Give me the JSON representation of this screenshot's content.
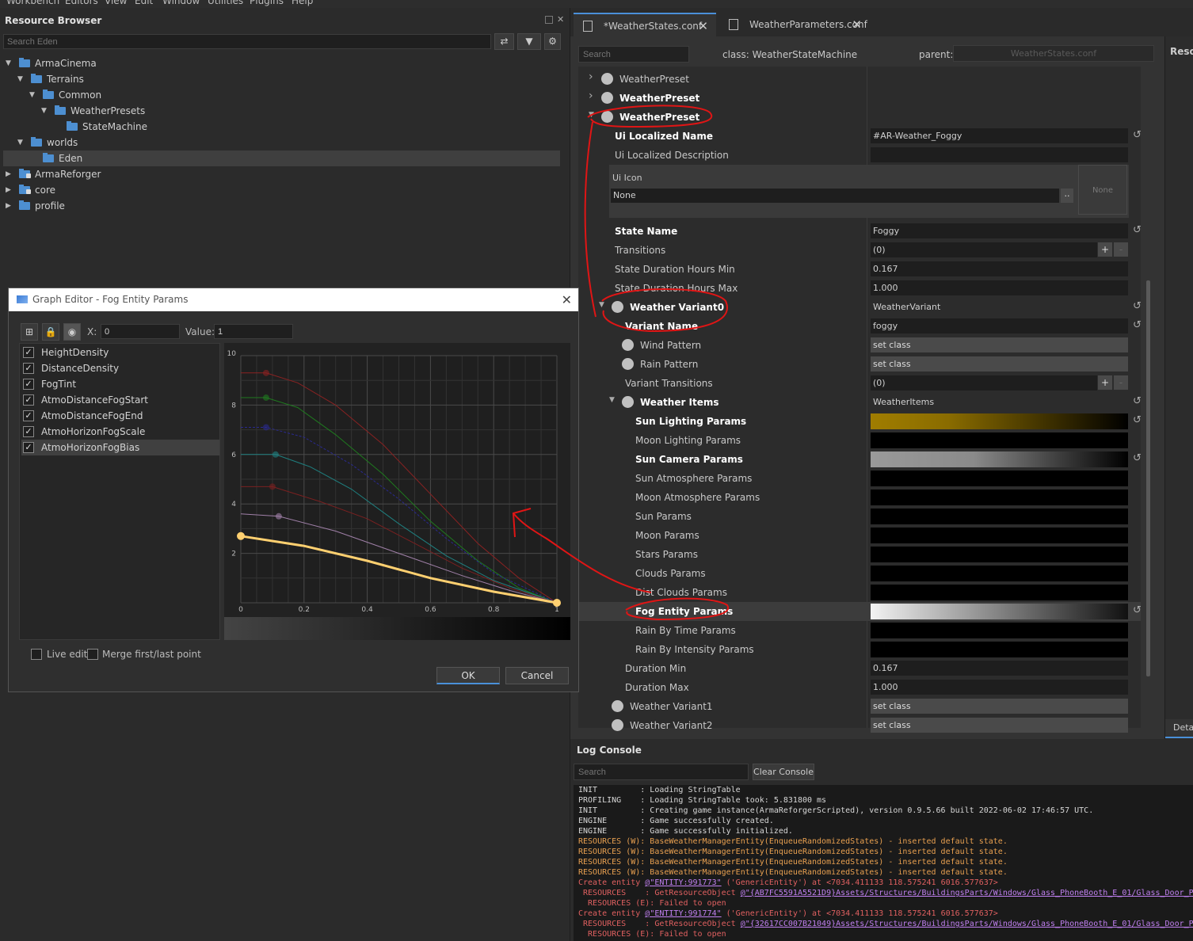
{
  "menu": [
    "Workbench",
    "Editors",
    "View",
    "Edit",
    "Window",
    "Utilities",
    "Plugins",
    "Help"
  ],
  "resource_browser": {
    "title": "Resource Browser",
    "search_placeholder": "Search Eden",
    "tree": [
      {
        "label": "ArmaCinema",
        "expanded": true
      },
      {
        "label": "Terrains",
        "expanded": true
      },
      {
        "label": "Common",
        "expanded": true
      },
      {
        "label": "WeatherPresets",
        "expanded": true
      },
      {
        "label": "StateMachine"
      },
      {
        "label": "worlds",
        "expanded": true
      },
      {
        "label": "Eden",
        "selected": true
      },
      {
        "label": "ArmaReforger",
        "locked": true
      },
      {
        "label": "core",
        "locked": true
      },
      {
        "label": "profile"
      }
    ]
  },
  "graph_editor": {
    "title": "Graph Editor - Fog Entity Params",
    "x_label": "X:",
    "x_value": "0",
    "value_label": "Value:",
    "value_value": "1",
    "items": [
      "HeightDensity",
      "DistanceDensity",
      "FogTint",
      "AtmoDistanceFogStart",
      "AtmoDistanceFogEnd",
      "AtmoHorizonFogScale",
      "AtmoHorizonFogBias"
    ],
    "live_edit": "Live edit",
    "merge": "Merge first/last point",
    "ok": "OK",
    "cancel": "Cancel"
  },
  "chart_data": {
    "type": "line",
    "x_ticks": [
      "0",
      "0.2",
      "0.4",
      "0.6",
      "0.8",
      "1"
    ],
    "y_ticks": [
      "2",
      "4",
      "6",
      "8",
      "10"
    ],
    "xlim": [
      0,
      1
    ],
    "ylim": [
      0,
      10
    ],
    "series": [
      {
        "color": "#8a2222",
        "points": [
          [
            0,
            9.3
          ],
          [
            0.08,
            9.3
          ],
          [
            0.18,
            8.9
          ],
          [
            0.3,
            8
          ],
          [
            0.45,
            6.4
          ],
          [
            0.6,
            4.4
          ],
          [
            0.75,
            2.4
          ],
          [
            0.88,
            1
          ],
          [
            1,
            0
          ]
        ]
      },
      {
        "color": "#1f7a1f",
        "points": [
          [
            0,
            8.3
          ],
          [
            0.08,
            8.3
          ],
          [
            0.18,
            7.9
          ],
          [
            0.3,
            6.8
          ],
          [
            0.45,
            5.2
          ],
          [
            0.6,
            3.3
          ],
          [
            0.75,
            1.7
          ],
          [
            0.88,
            0.6
          ],
          [
            1,
            0
          ]
        ]
      },
      {
        "color": "#2a2a90",
        "points": [
          [
            0,
            7.1
          ],
          [
            0.08,
            7.1
          ],
          [
            0.2,
            6.7
          ],
          [
            0.35,
            5.6
          ],
          [
            0.5,
            4.2
          ],
          [
            0.65,
            2.6
          ],
          [
            0.8,
            1.2
          ],
          [
            1,
            0
          ]
        ]
      },
      {
        "color": "#1f8080",
        "points": [
          [
            0,
            6
          ],
          [
            0.11,
            6
          ],
          [
            0.22,
            5.5
          ],
          [
            0.35,
            4.6
          ],
          [
            0.5,
            3.2
          ],
          [
            0.65,
            1.9
          ],
          [
            0.8,
            0.9
          ],
          [
            1,
            0
          ]
        ]
      },
      {
        "color": "#7a2020",
        "points": [
          [
            0,
            4.7
          ],
          [
            0.1,
            4.7
          ],
          [
            0.25,
            4.1
          ],
          [
            0.4,
            3.4
          ],
          [
            0.55,
            2.4
          ],
          [
            0.7,
            1.4
          ],
          [
            0.85,
            0.6
          ],
          [
            1,
            0
          ]
        ]
      },
      {
        "color": "#a080a8",
        "points": [
          [
            0,
            3.6
          ],
          [
            0.12,
            3.5
          ],
          [
            0.3,
            2.9
          ],
          [
            0.5,
            2
          ],
          [
            0.7,
            1.1
          ],
          [
            0.85,
            0.5
          ],
          [
            1,
            0
          ]
        ]
      },
      {
        "color": "#ffd070",
        "points": [
          [
            0,
            2.7
          ],
          [
            0.2,
            2.3
          ],
          [
            0.4,
            1.7
          ],
          [
            0.6,
            1
          ],
          [
            0.8,
            0.45
          ],
          [
            1,
            0
          ]
        ]
      }
    ]
  },
  "tabs": [
    {
      "label": "*WeatherStates.conf"
    },
    {
      "label": "WeatherParameters.conf"
    }
  ],
  "prop_editor": {
    "search_placeholder": "Search",
    "class_text": "class: WeatherStateMachine",
    "parent_label": "parent:",
    "parent_value": "WeatherStates.conf",
    "rows": [
      {
        "label": "WeatherPreset",
        "indent": 0,
        "arrow": "right",
        "circle": true
      },
      {
        "label": "WeatherPreset",
        "indent": 0,
        "arrow": "right",
        "circle": true,
        "bold": true
      },
      {
        "label": "WeatherPreset",
        "indent": 0,
        "arrow": "down",
        "circle": true,
        "bold": true
      },
      {
        "label": "Ui Localized Name",
        "indent": 1,
        "bold": true,
        "value": "#AR-Weather_Foggy",
        "reset": true
      },
      {
        "label": "Ui Localized Description",
        "indent": 1,
        "value": ""
      },
      {
        "type": "uiicon",
        "label": "Ui Icon",
        "value": "None",
        "button": "..",
        "preview": "None"
      },
      {
        "label": "State Name",
        "indent": 1,
        "bold": true,
        "value": "Foggy",
        "reset": true
      },
      {
        "label": "Transitions",
        "indent": 1,
        "value": "(0)",
        "plus": true
      },
      {
        "label": "State Duration Hours Min",
        "indent": 1,
        "value": "0.167"
      },
      {
        "label": "State Duration Hours Max",
        "indent": 1,
        "value": "1.000"
      },
      {
        "label": "Weather Variant0",
        "indent": 1,
        "arrow": "down",
        "circle": true,
        "bold": true,
        "value": "WeatherVariant",
        "plain": true,
        "reset": true
      },
      {
        "label": "Variant Name",
        "indent": 2,
        "bold": true,
        "value": "foggy",
        "reset": true
      },
      {
        "label": "Wind Pattern",
        "indent": 2,
        "circle": true,
        "value": "set class",
        "btn": true
      },
      {
        "label": "Rain Pattern",
        "indent": 2,
        "circle": true,
        "value": "set class",
        "btn": true
      },
      {
        "label": "Variant Transitions",
        "indent": 2,
        "value": "(0)",
        "plus": true
      },
      {
        "label": "Weather Items",
        "indent": 2,
        "arrow": "down",
        "circle": true,
        "bold": true,
        "value": "WeatherItems",
        "plain": true,
        "reset": true
      },
      {
        "label": "Sun Lighting Params",
        "indent": 3,
        "bold": true,
        "grad": "linear-gradient(90deg,#a07d00,#8a6c00 30%,#000 100%)",
        "reset": true
      },
      {
        "label": "Moon Lighting Params",
        "indent": 3,
        "grad": "#000"
      },
      {
        "label": "Sun Camera Params",
        "indent": 3,
        "bold": true,
        "grad": "linear-gradient(90deg,#9a9a9a,#8a8a8a 40%,#000 100%)",
        "reset": true
      },
      {
        "label": "Sun Atmosphere Params",
        "indent": 3,
        "grad": "#000"
      },
      {
        "label": "Moon Atmosphere Params",
        "indent": 3,
        "grad": "#000"
      },
      {
        "label": "Sun Params",
        "indent": 3,
        "grad": "#000"
      },
      {
        "label": "Moon Params",
        "indent": 3,
        "grad": "#000"
      },
      {
        "label": "Stars Params",
        "indent": 3,
        "grad": "#000"
      },
      {
        "label": "Clouds Params",
        "indent": 3,
        "grad": "#000"
      },
      {
        "label": "Dist Clouds Params",
        "indent": 3,
        "grad": "#000"
      },
      {
        "label": "Fog Entity Params",
        "indent": 3,
        "bold": true,
        "grad": "linear-gradient(90deg,#f2f2f2,#999 40%,#111 100%)",
        "reset": true,
        "highlight": true
      },
      {
        "label": "Rain By Time Params",
        "indent": 3,
        "grad": "#000"
      },
      {
        "label": "Rain By Intensity Params",
        "indent": 3,
        "grad": "#000"
      },
      {
        "label": "Duration Min",
        "indent": 2,
        "value": "0.167"
      },
      {
        "label": "Duration Max",
        "indent": 2,
        "value": "1.000"
      },
      {
        "label": "Weather Variant1",
        "indent": 1,
        "circle": true,
        "value": "set class",
        "btn": true
      },
      {
        "label": "Weather Variant2",
        "indent": 1,
        "circle": true,
        "value": "set class",
        "btn": true
      }
    ]
  },
  "right_panel": {
    "title": "Reso",
    "tab": "Deta"
  },
  "log_console": {
    "title": "Log Console",
    "search_placeholder": "Search",
    "clear": "Clear Console",
    "lines": [
      {
        "t": "INIT         : Loading StringTable",
        "k": ""
      },
      {
        "t": "PROFILING    : Loading StringTable took: 5.831800 ms",
        "k": ""
      },
      {
        "t": "INIT         : Creating game instance(ArmaReforgerScripted), version 0.9.5.66 built 2022-06-02 17:46:57 UTC.",
        "k": ""
      },
      {
        "t": "ENGINE       : Game successfully created.",
        "k": ""
      },
      {
        "t": "ENGINE       : Game successfully initialized.",
        "k": ""
      },
      {
        "t": "RESOURCES (W): BaseWeatherManagerEntity(EnqueueRandomizedStates) - inserted default state.",
        "k": "w"
      },
      {
        "t": "RESOURCES (W): BaseWeatherManagerEntity(EnqueueRandomizedStates) - inserted default state.",
        "k": "w"
      },
      {
        "t": "RESOURCES (W): BaseWeatherManagerEntity(EnqueueRandomizedStates) - inserted default state.",
        "k": "w"
      },
      {
        "t": "RESOURCES (W): BaseWeatherManagerEntity(EnqueueRandomizedStates) - inserted default state.",
        "k": "w"
      },
      {
        "t": "Create entity ",
        "link": "@\"ENTITY:991773\"",
        "t2": " ('GenericEntity') at <7034.411133 118.575241 6016.577637>",
        "k": "e"
      },
      {
        "t": " RESOURCES    : GetResourceObject ",
        "link": "@\"{AB7FC5591A5521D9}Assets/Structures/BuildingsParts/Windows/Glass_PhoneBooth_E_01/Glass_Door_Ph",
        "t2": "",
        "k": "e"
      },
      {
        "t": "  RESOURCES (E): Failed to open",
        "k": "e"
      },
      {
        "t": "Create entity ",
        "link": "@\"ENTITY:991774\"",
        "t2": " ('GenericEntity') at <7034.411133 118.575241 6016.577637>",
        "k": "e"
      },
      {
        "t": " RESOURCES    : GetResourceObject ",
        "link": "@\"{32617CC007B21049}Assets/Structures/BuildingsParts/Windows/Glass_PhoneBooth_E_01/Glass_Door_Ph",
        "t2": "",
        "k": "e"
      },
      {
        "t": "  RESOURCES (E): Failed to open",
        "k": "e"
      }
    ]
  }
}
